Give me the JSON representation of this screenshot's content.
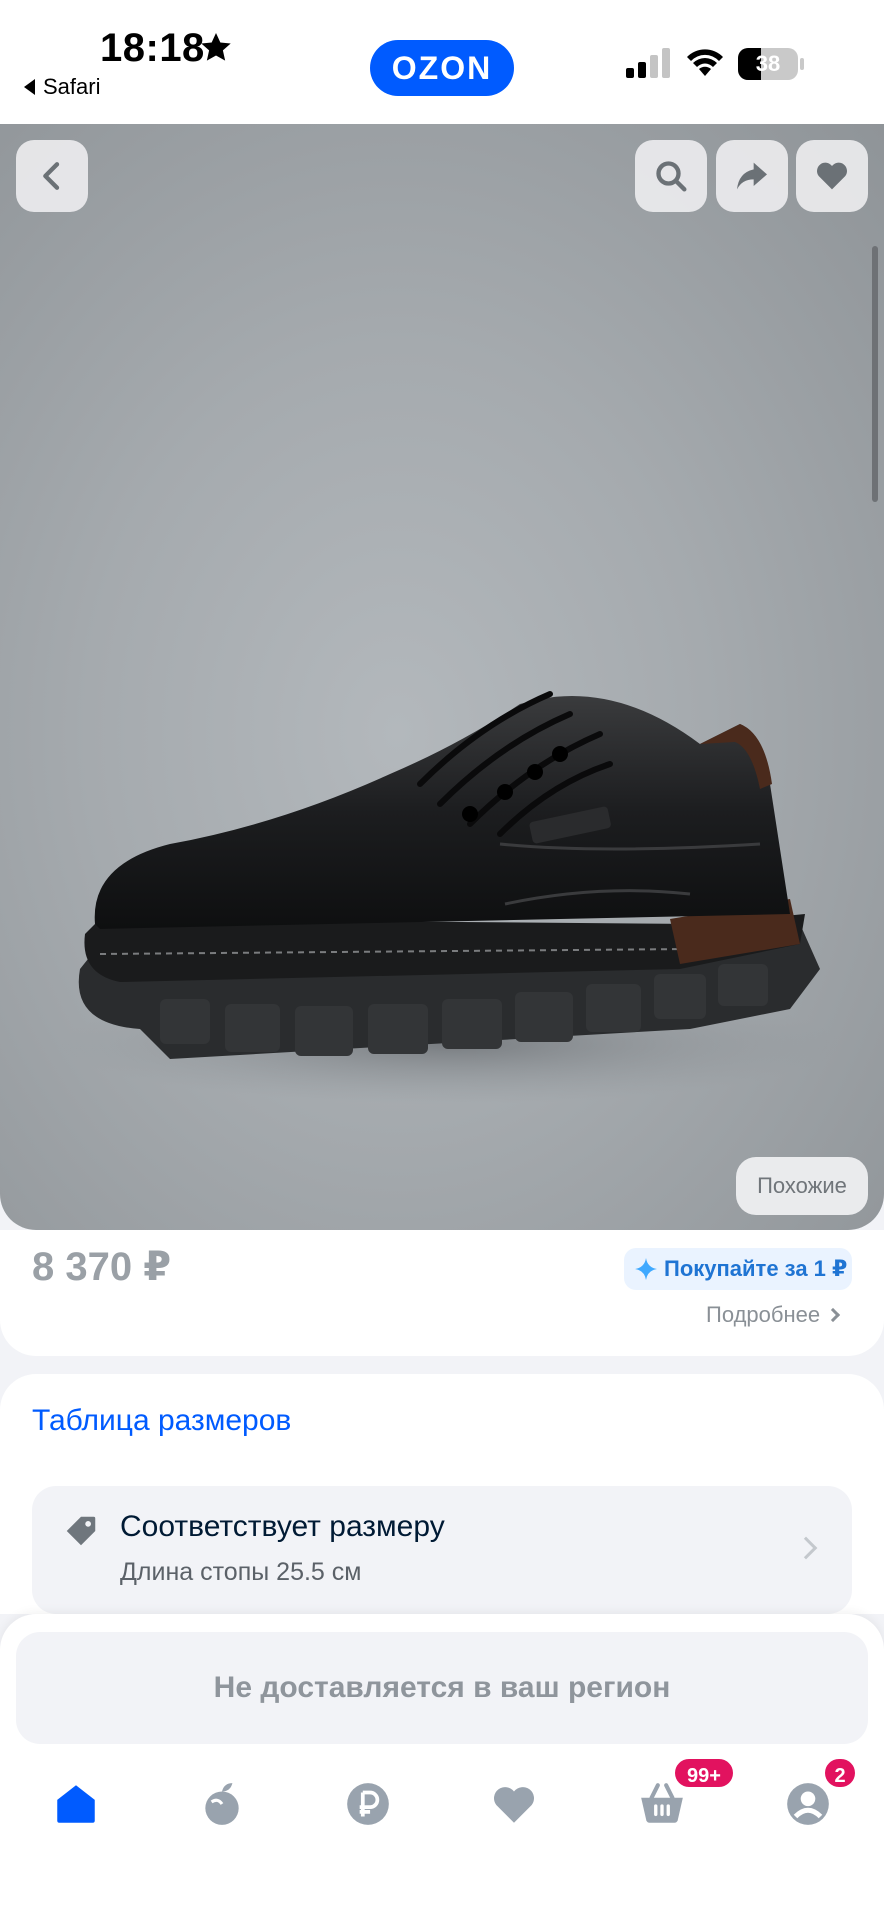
{
  "status_bar": {
    "time": "18:18",
    "back_label": "Safari",
    "battery_level": "38",
    "battery_fraction": 0.38,
    "icons": [
      "star-icon",
      "cellular-signal-icon",
      "wifi-icon",
      "battery-icon"
    ]
  },
  "header": {
    "logo_text": "OZON",
    "brand_color": "#005bff"
  },
  "gallery": {
    "buttons": [
      "back-button",
      "search-button",
      "share-button",
      "favorite-button"
    ],
    "similar_label": "Похожие",
    "image_subject": "black leather men's shoe"
  },
  "price_card": {
    "price": "8 370 ₽",
    "promo_label": "Покупайте за 1 ₽",
    "more_label": "Подробнее"
  },
  "size_card": {
    "size_table_label": "Таблица размеров",
    "fit_title": "Соответствует размеру",
    "fit_subtitle": "Длина стопы 25.5 см"
  },
  "bottom_sheet": {
    "delivery_notice": "Не доставляется в ваш регион"
  },
  "tabbar": {
    "tabs": [
      {
        "name": "home",
        "icon": "home-icon",
        "active": true
      },
      {
        "name": "fresh",
        "icon": "apple-icon"
      },
      {
        "name": "finance",
        "icon": "ruble-icon"
      },
      {
        "name": "favorites",
        "icon": "heart-icon"
      },
      {
        "name": "cart",
        "icon": "basket-icon",
        "badge": "99+"
      },
      {
        "name": "profile",
        "icon": "profile-icon",
        "badge": "2"
      }
    ],
    "active_color": "#005bff",
    "inactive_color": "#99a3ae",
    "badge_color": "#e2125f"
  }
}
